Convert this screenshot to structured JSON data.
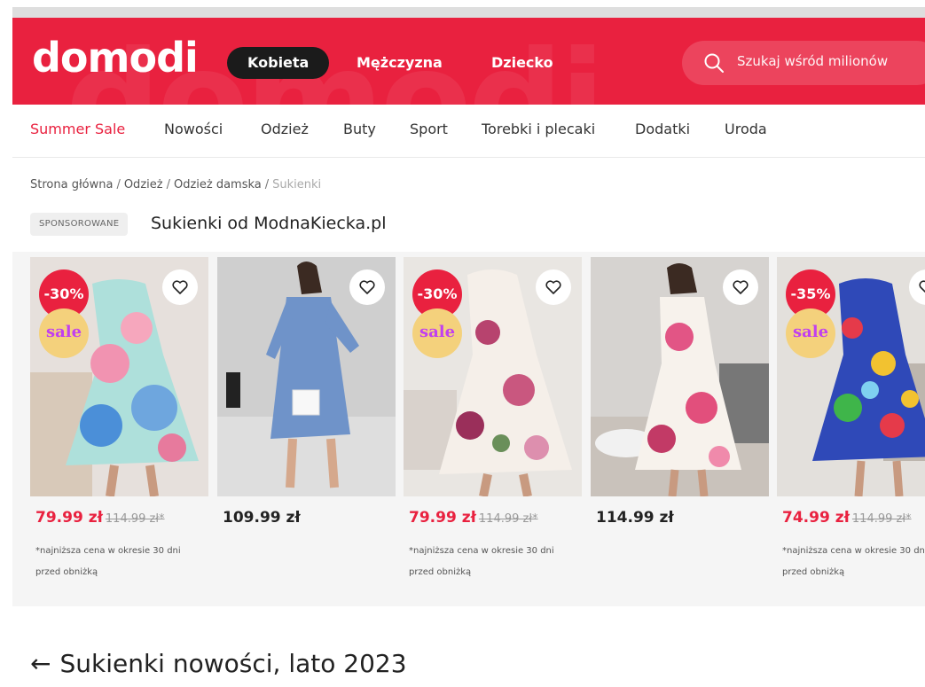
{
  "header": {
    "logo": "domodi",
    "ghost_text": "domodi",
    "gender_tabs": [
      {
        "label": "Kobieta",
        "active": true
      },
      {
        "label": "Mężczyzna",
        "active": false
      },
      {
        "label": "Dziecko",
        "active": false
      }
    ],
    "search": {
      "placeholder": "Szukaj wśród milionów",
      "icon": "search-icon"
    },
    "brand_color": "#e9213f"
  },
  "categories": [
    "Summer Sale",
    "Nowości",
    "Odzież",
    "Buty",
    "Sport",
    "Torebki i plecaki",
    "Dodatki",
    "Uroda"
  ],
  "breadcrumb": {
    "items": [
      "Strona główna",
      "Odzież",
      "Odzież damska"
    ],
    "current": "Sukienki"
  },
  "sponsored": {
    "badge": "SPONSOROWANE",
    "title": "Sukienki od ModnaKiecka.pl"
  },
  "products": [
    {
      "discount": "-30%",
      "sale_label": "sale",
      "price": "79.99 zł",
      "old_price": "114.99 zł*",
      "note_line1": "*najniższa cena w okresie 30 dni",
      "note_line2": "przed obniżką"
    },
    {
      "price": "109.99 zł"
    },
    {
      "discount": "-30%",
      "sale_label": "sale",
      "price": "79.99 zł",
      "old_price": "114.99 zł*",
      "note_line1": "*najniższa cena w okresie 30 dni",
      "note_line2": "przed obniżką"
    },
    {
      "price": "114.99 zł"
    },
    {
      "discount": "-35%",
      "sale_label": "sale",
      "price": "74.99 zł",
      "old_price": "114.99 zł*",
      "note_line1": "*najniższa cena w okresie 30 dni",
      "note_line2": "przed obniżką"
    }
  ],
  "section": {
    "arrow": "←",
    "title": "Sukienki nowości, lato 2023"
  }
}
